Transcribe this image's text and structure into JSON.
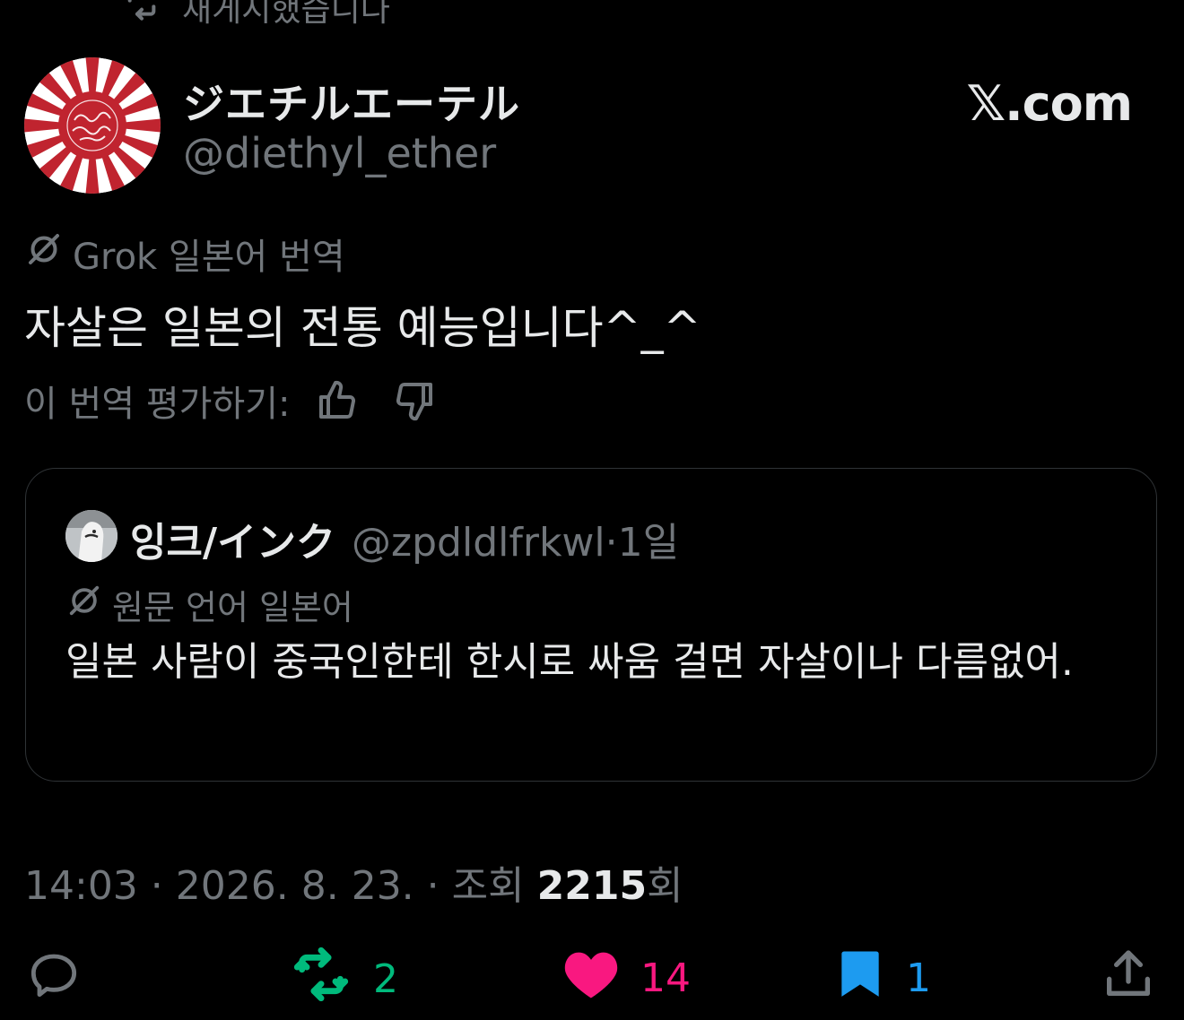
{
  "repost": {
    "icon": "repost-icon",
    "text": "재게시했습니다"
  },
  "author": {
    "display_name": "ジエチルエーテル",
    "handle": "@diethyl_ether"
  },
  "brand": "𝕏.com",
  "translation": {
    "label": "Grok 일본어 번역",
    "text": "자살은 일본의 전통 예능입니다^_^",
    "rate_label": "이 번역 평가하기:"
  },
  "quote": {
    "name": "잉크/インク",
    "handle": "@zpdldlfrkwl",
    "separator": "·",
    "age": "1일",
    "orig_lang_label": "원문 언어 일본어",
    "text": "일본 사람이 중국인한테 한시로 싸움 걸면 자살이나 다름없어."
  },
  "meta": {
    "time": "14:03",
    "sep1": " · ",
    "date": "2026. 8. 23.",
    "sep2": " · ",
    "views_label": "조회 ",
    "views": "2215",
    "views_suffix": "회"
  },
  "actions": {
    "reply": {
      "icon": "reply-icon",
      "count": ""
    },
    "repost": {
      "icon": "repost-icon",
      "count": "2",
      "color": "#00ba7c"
    },
    "like": {
      "icon": "heart-icon",
      "count": "14",
      "color": "#f91880"
    },
    "bookmark": {
      "icon": "bookmark-icon",
      "count": "1",
      "color": "#1d9bf0"
    },
    "share": {
      "icon": "share-icon"
    }
  },
  "colors": {
    "background": "#000000",
    "text": "#e7e9ea",
    "muted": "#71767b",
    "border": "#2f3336"
  }
}
